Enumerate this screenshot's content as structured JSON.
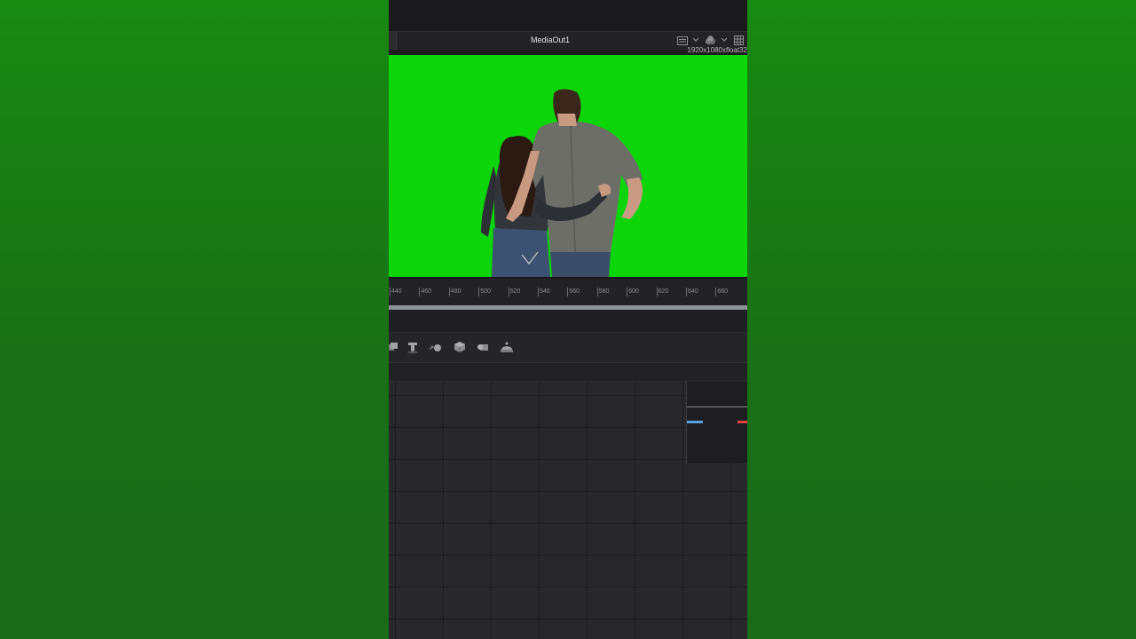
{
  "viewer": {
    "title": "MediaOut1",
    "resolution": "1920x1080xfloat32"
  },
  "ruler": {
    "ticks": [
      "440",
      "460",
      "480",
      "500",
      "520",
      "540",
      "560",
      "580",
      "600",
      "620",
      "640",
      "660"
    ]
  },
  "toolbar": {
    "tools": [
      {
        "icon": "merge-tool-icon"
      },
      {
        "icon": "text-tool-icon"
      },
      {
        "icon": "particles-tool-icon"
      },
      {
        "icon": "shape3d-tool-icon"
      },
      {
        "icon": "renderer3d-tool-icon"
      },
      {
        "icon": "merge3d-tool-icon"
      }
    ]
  },
  "colors": {
    "green_screen": "#0cd60a",
    "background_green": "#157a14",
    "panel": "#1c1c20"
  }
}
